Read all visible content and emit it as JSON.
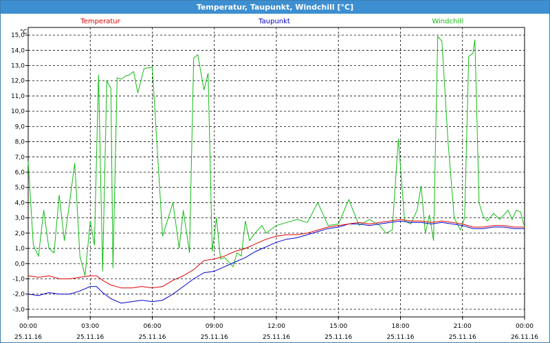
{
  "window": {
    "title": "Temperatur, Taupunkt, Windchill [°C]"
  },
  "colors": {
    "temperatur": "#dd0000",
    "taupunkt": "#0000cc",
    "windchill": "#11bb11",
    "titlebar": "#3d8fd1"
  },
  "chart_data": {
    "type": "line",
    "title": "Temperatur, Taupunkt, Windchill [°C]",
    "ylabel": "°C",
    "ylim": [
      -3.5,
      15.5
    ],
    "xlim": [
      0,
      24
    ],
    "grid": true,
    "legend_position": "top",
    "y_ticks": [
      "-3,0",
      "-2,0",
      "-1,0",
      "0,0",
      "1,0",
      "2,0",
      "3,0",
      "4,0",
      "5,0",
      "6,0",
      "7,0",
      "8,0",
      "9,0",
      "10,0",
      "11,0",
      "12,0",
      "13,0",
      "14,0",
      "15,0"
    ],
    "x_ticks": [
      {
        "time": "00:00",
        "date": "25.11.16"
      },
      {
        "time": "03:00",
        "date": "25.11.16"
      },
      {
        "time": "06:00",
        "date": "25.11.16"
      },
      {
        "time": "09:00",
        "date": "25.11.16"
      },
      {
        "time": "12:00",
        "date": "25.11.16"
      },
      {
        "time": "15:00",
        "date": "25.11.16"
      },
      {
        "time": "18:00",
        "date": "25.11.16"
      },
      {
        "time": "21:00",
        "date": "25.11.16"
      },
      {
        "time": "00:00",
        "date": "26.11.16"
      }
    ],
    "series": [
      {
        "name": "Temperatur",
        "x": [
          0,
          0.5,
          1,
          1.5,
          2,
          2.5,
          3,
          3.3,
          3.6,
          4,
          4.5,
          5,
          5.5,
          6,
          6.5,
          7,
          7.5,
          8,
          8.5,
          9,
          9.5,
          10,
          10.5,
          11,
          11.5,
          12,
          12.5,
          13,
          13.5,
          14,
          14.5,
          15,
          15.5,
          16,
          16.5,
          17,
          17.5,
          18,
          18.5,
          19,
          19.5,
          20,
          20.5,
          21,
          21.5,
          22,
          22.5,
          23,
          23.5,
          24
        ],
        "values": [
          -0.8,
          -0.9,
          -0.8,
          -1.0,
          -1.0,
          -0.9,
          -0.8,
          -0.8,
          -1.1,
          -1.4,
          -1.6,
          -1.6,
          -1.5,
          -1.6,
          -1.5,
          -1.1,
          -0.8,
          -0.4,
          0.2,
          0.3,
          0.5,
          0.8,
          1.0,
          1.3,
          1.6,
          1.8,
          1.9,
          1.9,
          2.0,
          2.2,
          2.4,
          2.5,
          2.6,
          2.7,
          2.6,
          2.7,
          2.8,
          2.9,
          2.8,
          2.8,
          2.7,
          2.8,
          2.7,
          2.6,
          2.4,
          2.4,
          2.5,
          2.5,
          2.4,
          2.4
        ]
      },
      {
        "name": "Taupunkt",
        "x": [
          0,
          0.5,
          1,
          1.5,
          2,
          2.5,
          3,
          3.3,
          3.6,
          4,
          4.5,
          5,
          5.5,
          6,
          6.5,
          7,
          7.5,
          8,
          8.5,
          9,
          9.5,
          10,
          10.5,
          11,
          11.5,
          12,
          12.5,
          13,
          13.5,
          14,
          14.5,
          15,
          15.5,
          16,
          16.5,
          17,
          17.5,
          18,
          18.5,
          19,
          19.5,
          20,
          20.5,
          21,
          21.5,
          22,
          22.5,
          23,
          23.5,
          24
        ],
        "values": [
          -2.0,
          -2.1,
          -1.9,
          -2.0,
          -2.0,
          -1.8,
          -1.5,
          -1.5,
          -1.9,
          -2.3,
          -2.6,
          -2.5,
          -2.4,
          -2.5,
          -2.4,
          -2.0,
          -1.5,
          -1.0,
          -0.6,
          -0.5,
          -0.2,
          0.1,
          0.4,
          0.8,
          1.1,
          1.4,
          1.6,
          1.7,
          1.9,
          2.1,
          2.3,
          2.4,
          2.6,
          2.6,
          2.5,
          2.6,
          2.7,
          2.8,
          2.7,
          2.7,
          2.6,
          2.7,
          2.6,
          2.5,
          2.3,
          2.3,
          2.4,
          2.4,
          2.3,
          2.3
        ]
      },
      {
        "name": "Windchill",
        "x": [
          0,
          0.25,
          0.5,
          0.75,
          1,
          1.25,
          1.5,
          1.75,
          2,
          2.25,
          2.5,
          2.75,
          3,
          3.2,
          3.4,
          3.6,
          3.8,
          4,
          4.1,
          4.3,
          4.5,
          4.7,
          4.9,
          5.1,
          5.3,
          5.6,
          6,
          6.5,
          7,
          7.3,
          7.5,
          7.8,
          8,
          8.2,
          8.5,
          8.7,
          8.9,
          9.1,
          9.3,
          9.5,
          9.9,
          10.1,
          10.3,
          10.5,
          10.7,
          10.9,
          11.1,
          11.3,
          11.5,
          12,
          12.5,
          13,
          13.5,
          14,
          14.5,
          15,
          15.5,
          16,
          16.5,
          17,
          17.3,
          17.6,
          17.9,
          18.2,
          18.5,
          18.8,
          19,
          19.2,
          19.4,
          19.6,
          19.8,
          20,
          20.3,
          20.6,
          20.9,
          21.1,
          21.3,
          21.5,
          21.6,
          21.8,
          22,
          22.2,
          22.5,
          22.8,
          23,
          23.2,
          23.4,
          23.6,
          23.8,
          24
        ],
        "values": [
          6.7,
          1.2,
          0.5,
          3.5,
          1.0,
          0.7,
          4.5,
          1.5,
          4.0,
          6.6,
          0.5,
          -0.8,
          2.8,
          1.2,
          12.4,
          -0.5,
          12.0,
          11.5,
          -0.3,
          12.2,
          12.1,
          12.3,
          12.4,
          12.6,
          11.2,
          12.8,
          12.9,
          1.8,
          4.0,
          1.0,
          3.5,
          0.7,
          13.5,
          13.7,
          11.4,
          12.5,
          0.8,
          3.0,
          0.3,
          0.4,
          -0.2,
          0.7,
          0.5,
          2.8,
          1.5,
          1.9,
          2.2,
          2.5,
          2.0,
          2.5,
          2.7,
          2.9,
          2.7,
          4.0,
          2.5,
          2.6,
          4.2,
          2.5,
          2.9,
          2.5,
          2.0,
          2.2,
          8.2,
          2.8,
          2.6,
          3.5,
          5.1,
          2.0,
          3.2,
          1.5,
          14.9,
          14.6,
          8.0,
          3.0,
          2.2,
          3.0,
          13.6,
          13.8,
          14.7,
          4.0,
          3.1,
          2.8,
          3.3,
          2.9,
          3.2,
          3.5,
          2.9,
          3.5,
          3.4,
          2.4
        ]
      }
    ]
  }
}
